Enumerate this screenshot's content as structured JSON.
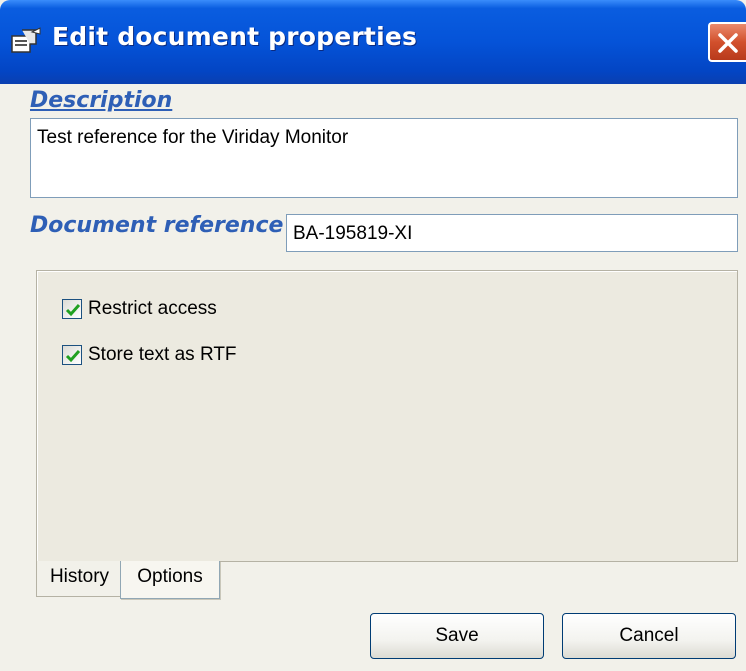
{
  "window": {
    "title": "Edit document properties"
  },
  "description": {
    "label": "Description",
    "value": "Test reference for the Viriday Monitor"
  },
  "document_reference": {
    "label": "Document reference",
    "value": "BA-195819-XI"
  },
  "options": {
    "items": [
      {
        "label": "Restrict access",
        "checked": true
      },
      {
        "label": "Store text as RTF",
        "checked": true
      }
    ]
  },
  "tabs": [
    {
      "label": "History",
      "active": false
    },
    {
      "label": "Options",
      "active": true
    }
  ],
  "buttons": {
    "save_label": "Save",
    "cancel_label": "Cancel"
  },
  "icons": {
    "title": "document-properties-icon",
    "close": "close-icon"
  },
  "colors": {
    "titlebar": "#0553d8",
    "label_blue": "#2e5fb6",
    "close_red": "#d2502c"
  }
}
